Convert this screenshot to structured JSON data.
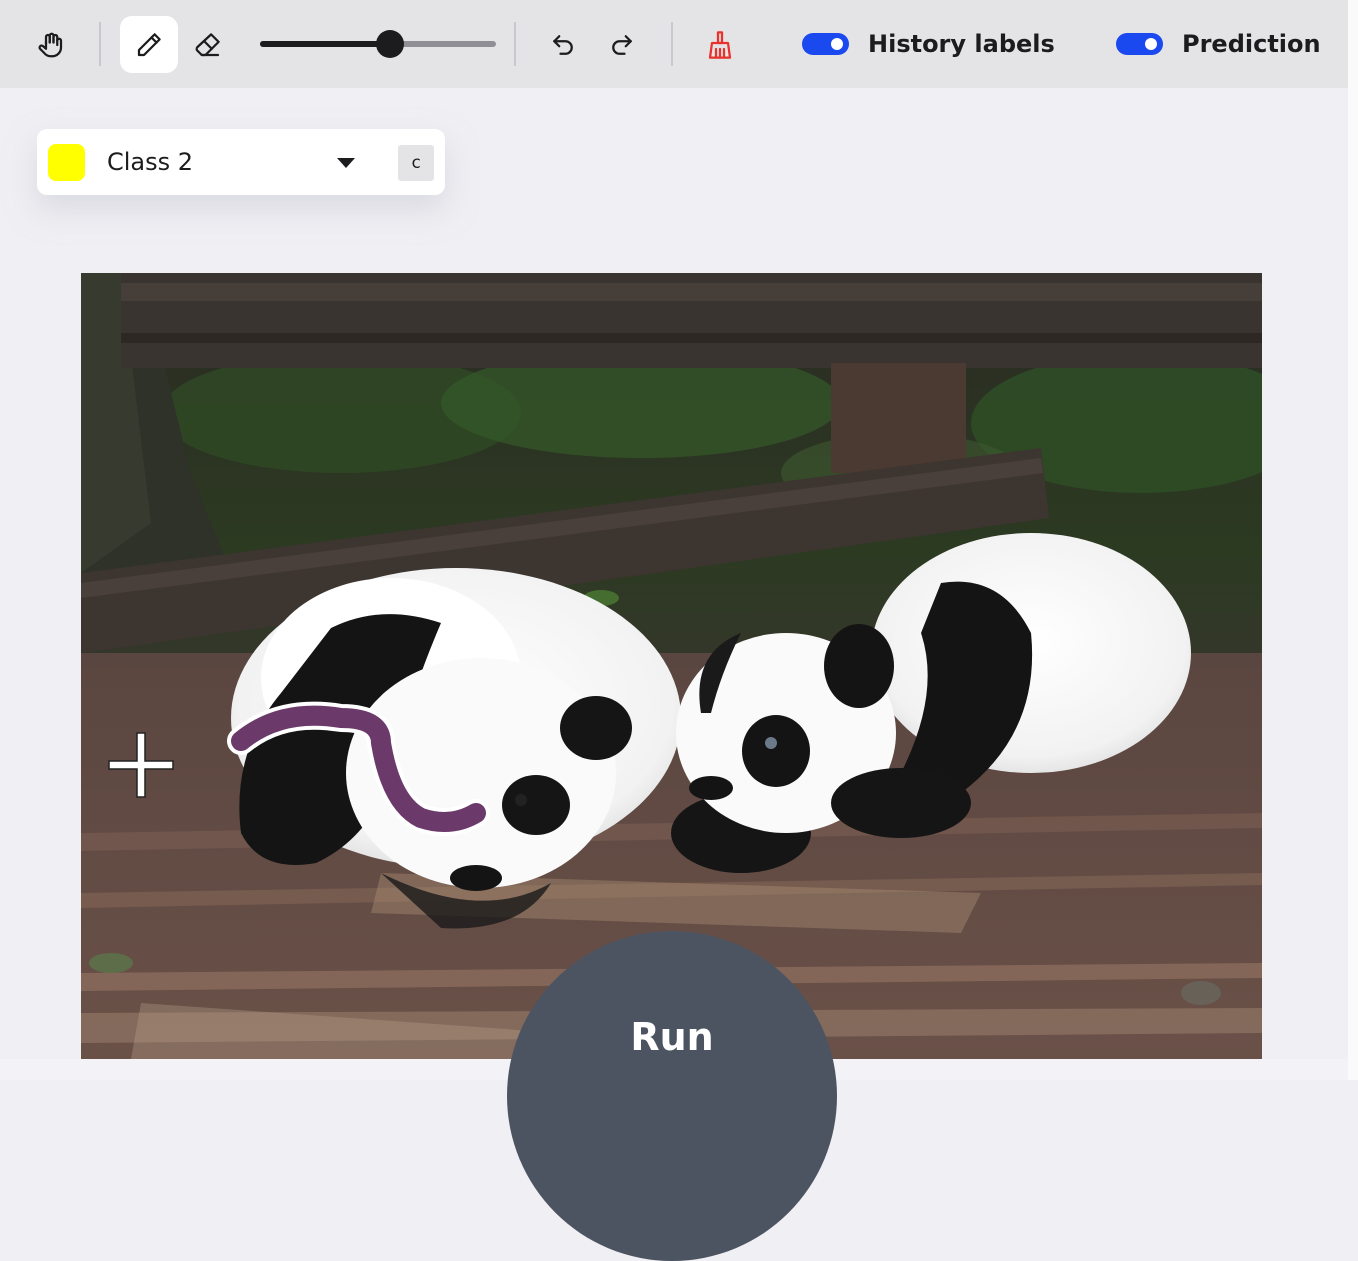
{
  "toolbar": {
    "tools": [
      {
        "name": "pan",
        "icon": "hand-icon",
        "active": false
      },
      {
        "name": "brush",
        "icon": "pencil-icon",
        "active": true
      },
      {
        "name": "eraser",
        "icon": "eraser-icon",
        "active": false
      }
    ],
    "brush_size": {
      "value": 0.55,
      "icon": "slider"
    },
    "history": {
      "undo_icon": "undo-icon",
      "redo_icon": "redo-icon"
    },
    "clear_icon": "broom-icon",
    "toggles": [
      {
        "label": "History labels",
        "on": true
      },
      {
        "label": "Prediction",
        "on": true
      }
    ]
  },
  "class_selector": {
    "label": "Class 2",
    "color": "#ffff00",
    "shortcut": "c"
  },
  "canvas": {
    "stroke_color": "#6b3a6b",
    "cursor_icon": "crosshair-icon"
  },
  "run_button": {
    "label": "Run"
  },
  "colors": {
    "accent_toggle": "#1a49f0",
    "clear_icon": "#e8332c",
    "run_bg": "#4d5461"
  }
}
